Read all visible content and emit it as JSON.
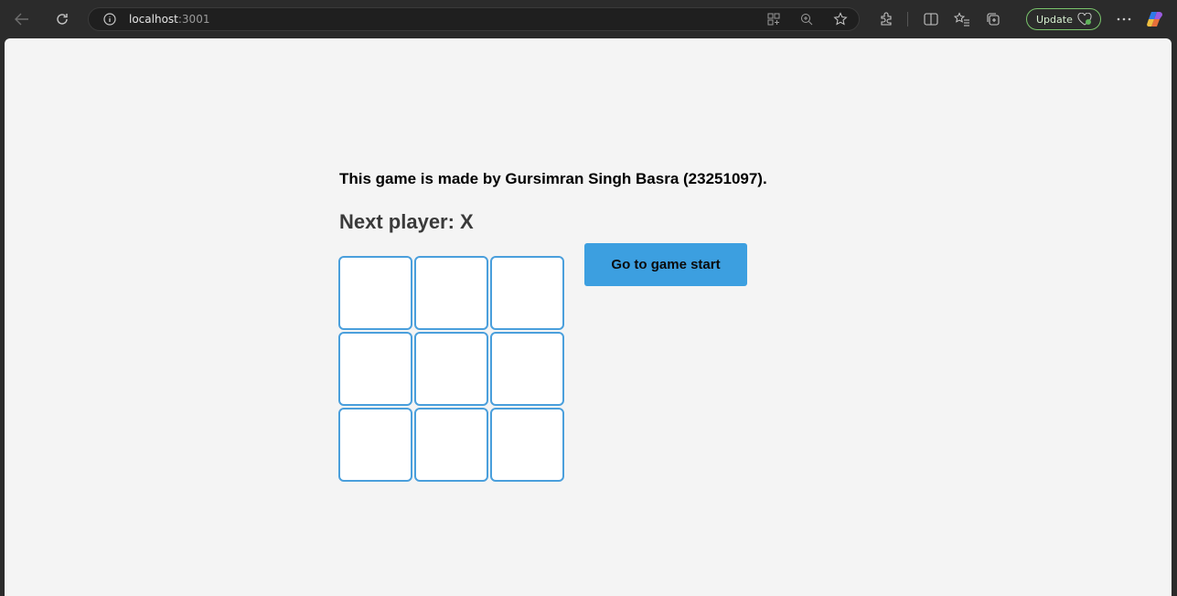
{
  "browser": {
    "url_host": "localhost",
    "url_port": ":3001",
    "update_label": "Update",
    "icons": [
      "back-icon",
      "refresh-icon",
      "site-info-icon",
      "app-grid-icon",
      "zoom-icon",
      "favorite-star-icon",
      "extensions-icon",
      "split-screen-icon",
      "favorites-icon",
      "collections-icon",
      "heart-icon",
      "more-icon",
      "copilot-icon"
    ]
  },
  "page": {
    "credit": "This game is made by Gursimran Singh Basra (23251097).",
    "status": "Next player: X",
    "board": [
      "",
      "",
      "",
      "",
      "",
      "",
      "",
      "",
      ""
    ],
    "moves": [
      {
        "label": "Go to game start"
      }
    ]
  },
  "colors": {
    "square_border": "#4a9fdc",
    "button_bg": "#3c9fe0",
    "page_bg": "#f4f4f4",
    "chrome_bg": "#2b2b2b"
  }
}
